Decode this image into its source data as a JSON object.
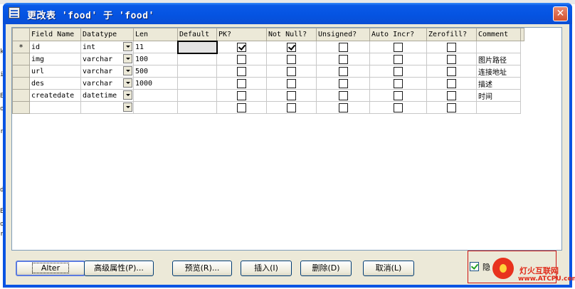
{
  "window": {
    "title": "更改表 'food' 于 'food'",
    "close_symbol": "✕"
  },
  "grid": {
    "columns": [
      "Field Name",
      "Datatype",
      "Len",
      "Default",
      "PK?",
      "Not Null?",
      "Unsigned?",
      "Auto Incr?",
      "Zerofill?",
      "Comment"
    ],
    "current_row_marker": "*",
    "rows": [
      {
        "field": "id",
        "type": "int",
        "len": "11",
        "default": "",
        "pk": true,
        "notnull": true,
        "unsigned": false,
        "autoincr": false,
        "zerofill": false,
        "comment": ""
      },
      {
        "field": "img",
        "type": "varchar",
        "len": "100",
        "default": "",
        "pk": false,
        "notnull": false,
        "unsigned": false,
        "autoincr": false,
        "zerofill": false,
        "comment": "图片路径"
      },
      {
        "field": "url",
        "type": "varchar",
        "len": "500",
        "default": "",
        "pk": false,
        "notnull": false,
        "unsigned": false,
        "autoincr": false,
        "zerofill": false,
        "comment": "连接地址"
      },
      {
        "field": "des",
        "type": "varchar",
        "len": "1000",
        "default": "",
        "pk": false,
        "notnull": false,
        "unsigned": false,
        "autoincr": false,
        "zerofill": false,
        "comment": "描述"
      },
      {
        "field": "createdate",
        "type": "datetime",
        "len": "",
        "default": "",
        "pk": false,
        "notnull": false,
        "unsigned": false,
        "autoincr": false,
        "zerofill": false,
        "comment": "时间"
      },
      {
        "field": "",
        "type": "",
        "len": "",
        "default": "",
        "pk": false,
        "notnull": false,
        "unsigned": false,
        "autoincr": false,
        "zerofill": false,
        "comment": ""
      }
    ]
  },
  "buttons": {
    "alter": "Alter",
    "advanced": "高级属性(P)...",
    "preview": "预览(R)...",
    "insert": "插入(I)",
    "delete": "删除(D)",
    "cancel": "取消(L)"
  },
  "hide_checkbox": {
    "label": "隐",
    "checked": true
  },
  "watermark": {
    "line1": "灯火互联网",
    "line2": "www.ATCPU.com"
  },
  "background_editor_chars": [
    "k",
    "i",
    "E",
    "on",
    "rs",
    "d",
    "E",
    "on",
    "rs"
  ],
  "colors": {
    "titlebar": "#0553e1",
    "dialog_face": "#ece9d8",
    "default_header": "#f7d8a0",
    "highlight_box": "#cc1111",
    "watermark": "#e02a18"
  }
}
